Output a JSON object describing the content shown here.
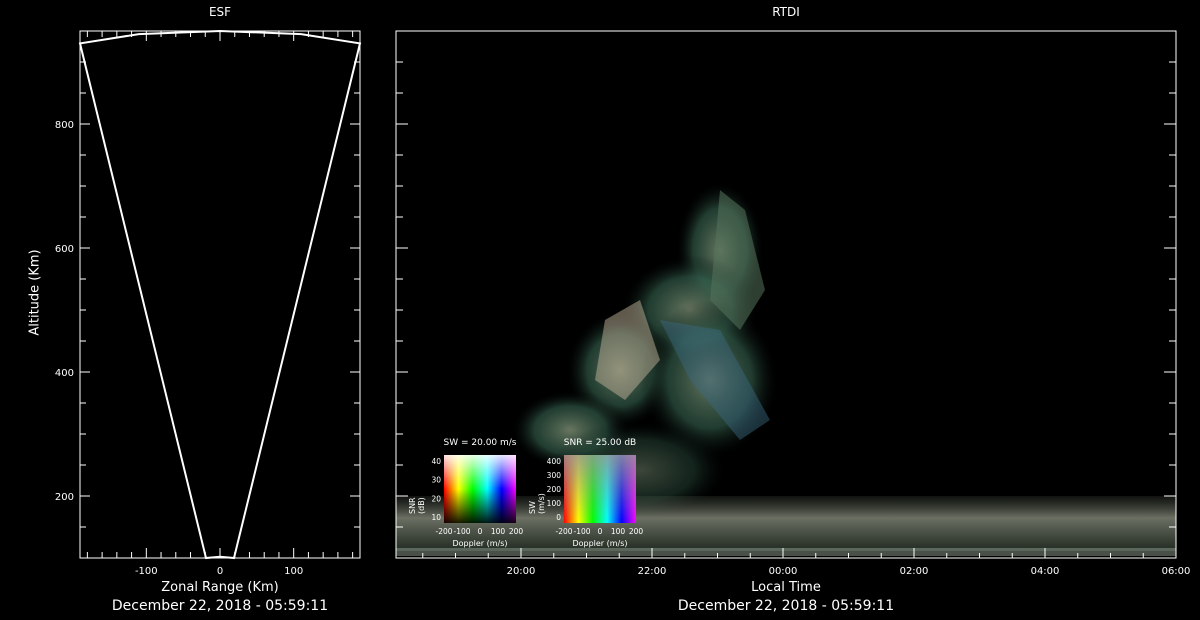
{
  "esf": {
    "title": "ESF",
    "xlabel": "Zonal Range (Km)",
    "ylabel": "Altitude (Km)",
    "xticks": [
      "-100",
      "0",
      "100"
    ],
    "yticks": [
      "200",
      "400",
      "600",
      "800"
    ],
    "date": "December 22, 2018 - 05:59:11"
  },
  "rtdi": {
    "title": "RTDI",
    "xlabel": "Local Time",
    "xticks": [
      "20:00",
      "22:00",
      "00:00",
      "02:00",
      "04:00",
      "06:00"
    ],
    "date": "December 22, 2018 - 05:59:11"
  },
  "legend_sw": {
    "title": "SW = 20.00 m/s",
    "xlabel": "Doppler (m/s)",
    "ylabel": "SNR (dB)",
    "xticks": [
      "-200",
      "-100",
      "0",
      "100",
      "200"
    ],
    "yticks": [
      "10",
      "20",
      "30",
      "40"
    ]
  },
  "legend_snr": {
    "title": "SNR = 25.00 dB",
    "xlabel": "Doppler (m/s)",
    "ylabel": "SW (m/s)",
    "xticks": [
      "-200",
      "-100",
      "0",
      "100",
      "200"
    ],
    "yticks": [
      "0",
      "100",
      "200",
      "300",
      "400"
    ]
  },
  "chart_data": [
    {
      "type": "line",
      "title": "ESF",
      "xlabel": "Zonal Range (Km)",
      "ylabel": "Altitude (Km)",
      "xlim": [
        -190,
        190
      ],
      "ylim": [
        100,
        950
      ],
      "series": [
        {
          "x": [
            -19,
            -190,
            -110,
            0,
            110,
            190,
            19,
            0,
            -19
          ],
          "y": [
            100,
            930,
            945,
            950,
            945,
            930,
            100,
            102,
            100
          ]
        }
      ]
    },
    {
      "type": "heatmap",
      "title": "RTDI",
      "xlabel": "Local Time",
      "ylabel": "Altitude (Km)",
      "xticks": [
        "20:00",
        "22:00",
        "00:00",
        "02:00",
        "04:00",
        "06:00"
      ],
      "ylim": [
        100,
        950
      ]
    }
  ]
}
